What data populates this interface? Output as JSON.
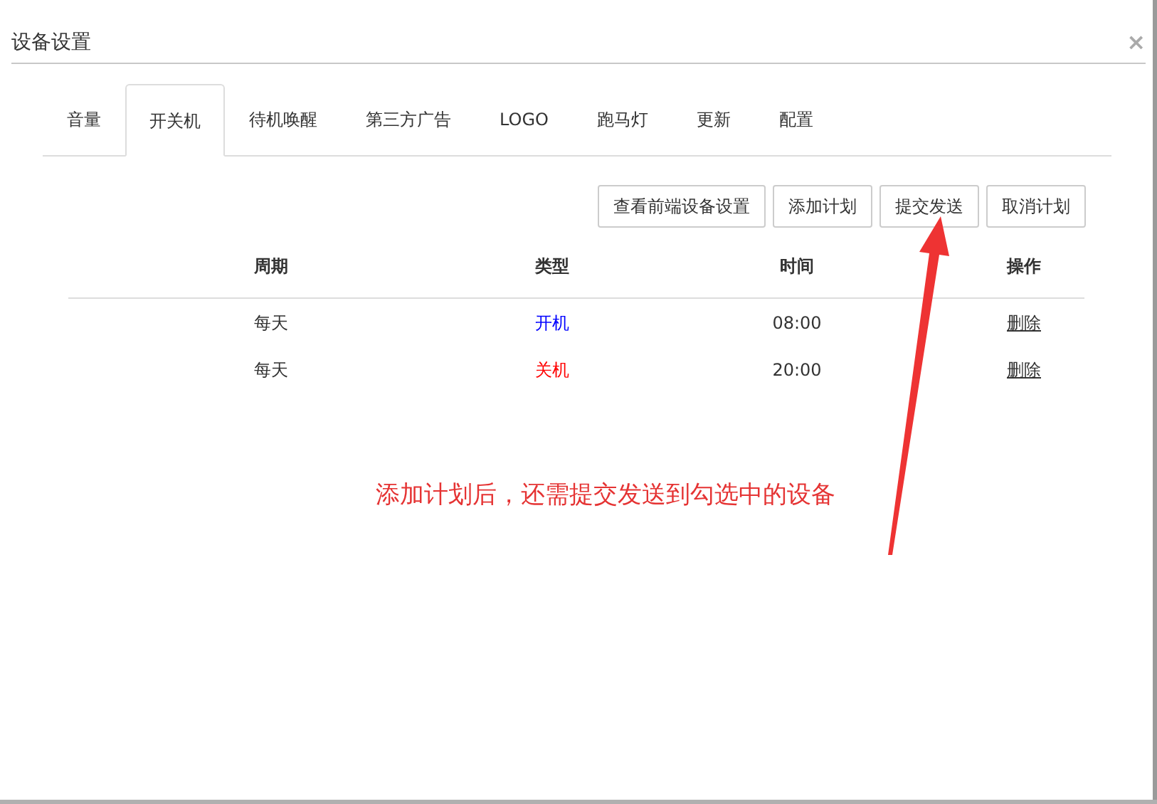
{
  "window": {
    "title": "设备设置",
    "close": "×"
  },
  "tabs": [
    {
      "label": "音量",
      "selected": false
    },
    {
      "label": "开关机",
      "selected": true
    },
    {
      "label": "待机唤醒",
      "selected": false
    },
    {
      "label": "第三方广告",
      "selected": false
    },
    {
      "label": "LOGO",
      "selected": false
    },
    {
      "label": "跑马灯",
      "selected": false
    },
    {
      "label": "更新",
      "selected": false
    },
    {
      "label": "配置",
      "selected": false
    }
  ],
  "buttons": [
    "查看前端设备设置",
    "添加计划",
    "提交发送",
    "取消计划"
  ],
  "table": {
    "columns": [
      "周期",
      "类型",
      "时间",
      "操作"
    ],
    "rows": [
      {
        "period": "每天",
        "type": "开机",
        "color": "#0000ff",
        "time": "08:00",
        "action": "删除"
      },
      {
        "period": "每天",
        "type": "关机",
        "color": "#ff0000",
        "time": "20:00",
        "action": "删除"
      }
    ]
  },
  "annotation": "添加计划后，还需提交发送到勾选中的设备"
}
